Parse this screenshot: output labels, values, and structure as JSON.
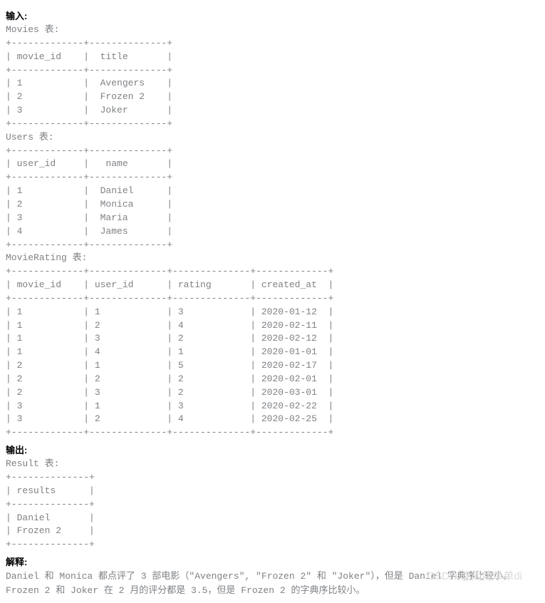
{
  "labels": {
    "input": "输入:",
    "output": "输出:",
    "explain": "解释:"
  },
  "movies": {
    "caption": "Movies 表:",
    "divider": "+-------------+--------------+",
    "header": "| movie_id    |  title       |",
    "rows": [
      "| 1           |  Avengers    |",
      "| 2           |  Frozen 2    |",
      "| 3           |  Joker       |"
    ]
  },
  "users": {
    "caption": "Users 表:",
    "divider": "+-------------+--------------+",
    "header": "| user_id     |   name       |",
    "rows": [
      "| 1           |  Daniel      |",
      "| 2           |  Monica      |",
      "| 3           |  Maria       |",
      "| 4           |  James       |"
    ]
  },
  "movie_rating": {
    "caption": "MovieRating 表:",
    "divider": "+-------------+--------------+--------------+-------------+",
    "header": "| movie_id    | user_id      | rating       | created_at  |",
    "rows": [
      "| 1           | 1            | 3            | 2020-01-12  |",
      "| 1           | 2            | 4            | 2020-02-11  |",
      "| 1           | 3            | 2            | 2020-02-12  |",
      "| 1           | 4            | 1            | 2020-01-01  |",
      "| 2           | 1            | 5            | 2020-02-17  |",
      "| 2           | 2            | 2            | 2020-02-01  |",
      "| 2           | 3            | 2            | 2020-03-01  |",
      "| 3           | 1            | 3            | 2020-02-22  |",
      "| 3           | 2            | 4            | 2020-02-25  |"
    ]
  },
  "result": {
    "caption": "Result 表:",
    "divider": "+--------------+",
    "header": "| results      |",
    "rows": [
      "| Daniel       |",
      "| Frozen 2     |"
    ]
  },
  "explain_lines": {
    "l1": "Daniel 和 Monica 都点评了 3 部电影（\"Avengers\", \"Frozen 2\" 和 \"Joker\"），但是 Daniel 字典序比较小。",
    "l2": "Frozen 2 和 Joker 在 2 月的评分都是 3.5，但是 Frozen 2 的字典序比较小。"
  },
  "watermark": "CSDN @简简单单di"
}
